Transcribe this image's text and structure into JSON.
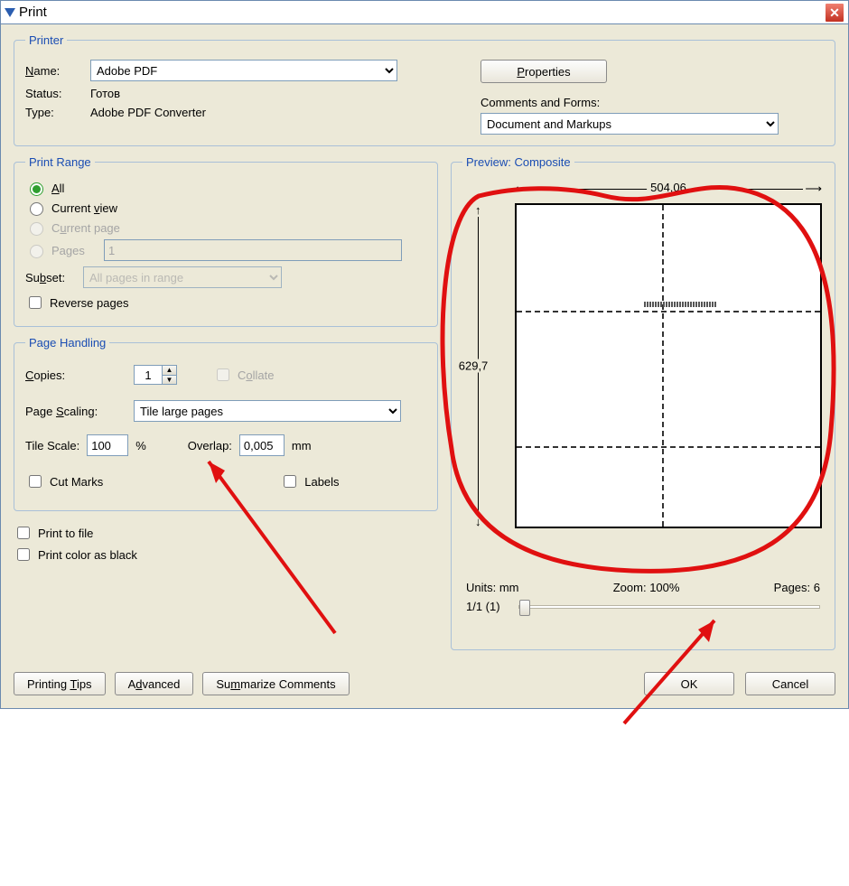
{
  "title": "Print",
  "printer": {
    "legend": "Printer",
    "name_label": "Name:",
    "name_value": "Adobe PDF",
    "properties_label": "Properties",
    "status_label": "Status:",
    "status_value": "Готов",
    "type_label": "Type:",
    "type_value": "Adobe PDF Converter",
    "comments_label": "Comments and Forms:",
    "comments_value": "Document and Markups"
  },
  "range": {
    "legend": "Print Range",
    "all": "All",
    "current_view": "Current view",
    "current_page": "Current page",
    "pages_label": "Pages",
    "pages_value": "1",
    "subset_label": "Subset:",
    "subset_value": "All pages in range",
    "reverse": "Reverse pages"
  },
  "handling": {
    "legend": "Page Handling",
    "copies_label": "Copies:",
    "copies_value": "1",
    "collate_label": "Collate",
    "scaling_label": "Page Scaling:",
    "scaling_value": "Tile large pages",
    "tile_scale_label": "Tile Scale:",
    "tile_scale_value": "100",
    "tile_scale_unit": "%",
    "overlap_label": "Overlap:",
    "overlap_value": "0,005",
    "overlap_unit": "mm",
    "cut_marks": "Cut Marks",
    "labels": "Labels"
  },
  "extras": {
    "print_to_file": "Print to file",
    "print_color_black": "Print color as black"
  },
  "preview": {
    "legend": "Preview: Composite",
    "width_dim": "504,06",
    "height_dim": "629,7",
    "units_label": "Units: mm",
    "zoom_label": "Zoom: 100%",
    "pages_label": "Pages: 6",
    "nav_text": "1/1 (1)"
  },
  "buttons": {
    "tips": "Printing Tips",
    "advanced": "Advanced",
    "summarize": "Summarize Comments",
    "ok": "OK",
    "cancel": "Cancel"
  }
}
